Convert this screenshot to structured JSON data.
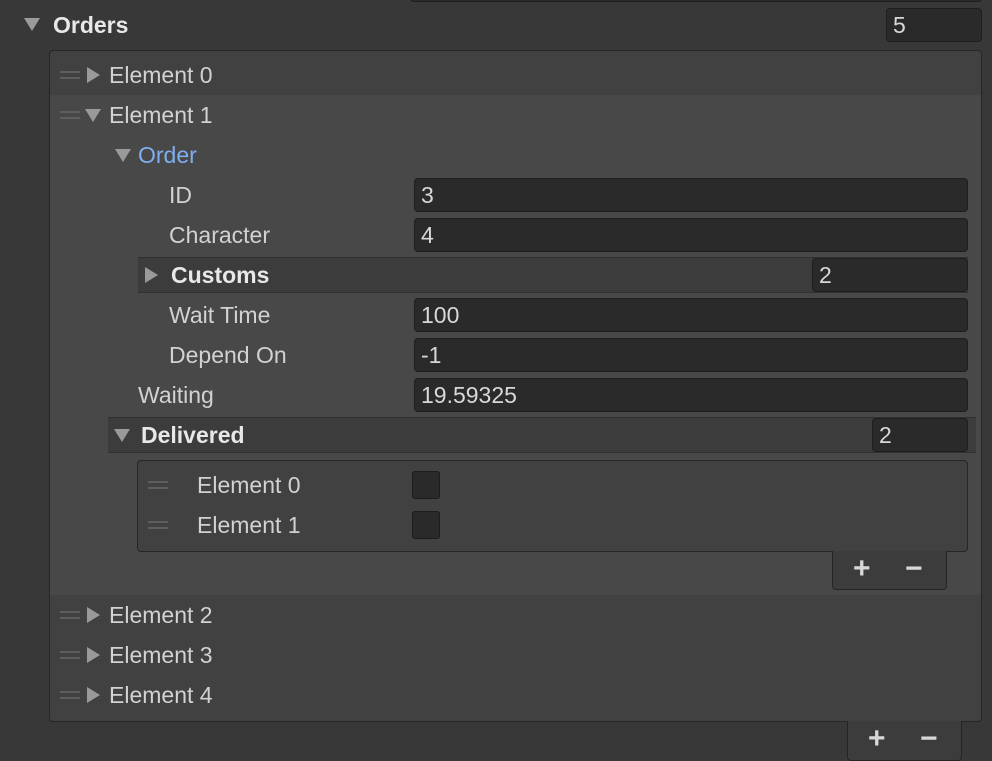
{
  "orders": {
    "label": "Orders",
    "size": "5",
    "elements": {
      "e0": "Element 0",
      "e1": "Element 1",
      "e2": "Element 2",
      "e3": "Element 3",
      "e4": "Element 4"
    },
    "order": {
      "label": "Order",
      "id_label": "ID",
      "id_value": "3",
      "character_label": "Character",
      "character_value": "4",
      "customs_label": "Customs",
      "customs_size": "2",
      "wait_time_label": "Wait Time",
      "wait_time_value": "100",
      "depend_on_label": "Depend On",
      "depend_on_value": "-1"
    },
    "waiting_label": "Waiting",
    "waiting_value": "19.59325",
    "delivered": {
      "label": "Delivered",
      "size": "2",
      "items": [
        "Element 0",
        "Element 1"
      ]
    },
    "add_symbol": "+",
    "remove_symbol": "−"
  },
  "colors": {
    "background": "#383838",
    "field": "#2a2a2a",
    "accent_label": "#7faef0"
  }
}
